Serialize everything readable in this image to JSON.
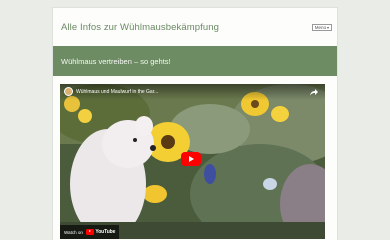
{
  "header": {
    "site_title": "Alle Infos zur Wühlmausbekämpfung",
    "menu_label": "Menü"
  },
  "banner": {
    "page_heading": "Wühlmaus vertreiben – so gehts!"
  },
  "video": {
    "title": "Wühlmaus und Maulwurf in the Gar...",
    "watch_on_label": "Watch on",
    "platform_name": "YouTube",
    "accent_color": "#ff0000"
  },
  "colors": {
    "brand_green": "#6d8c63",
    "page_background": "#e9ece7"
  }
}
